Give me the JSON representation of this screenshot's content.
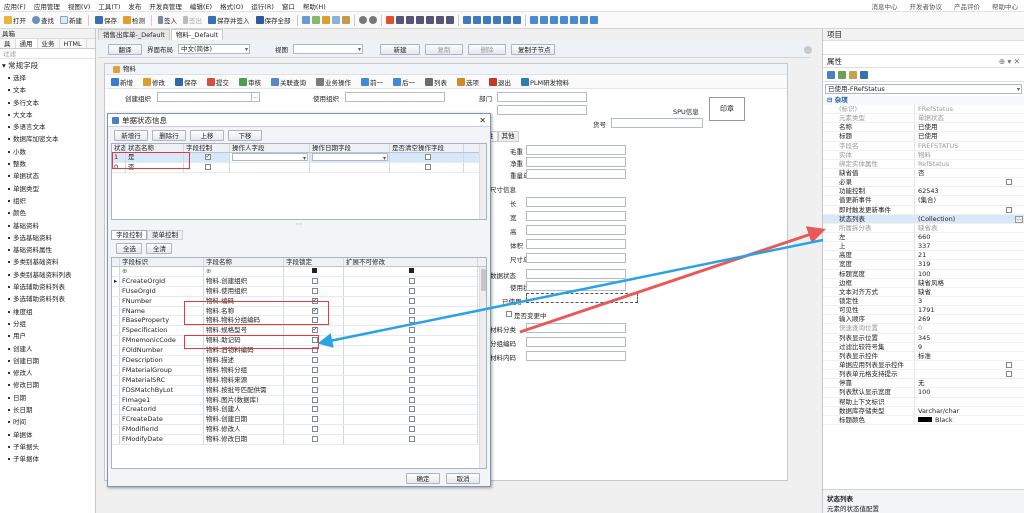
{
  "menu": {
    "items": [
      "应用(F)",
      "应用管理",
      "视图(V)",
      "工具(T)",
      "发布",
      "开发商管理",
      "编辑(E)",
      "格式(O)",
      "运行(R)",
      "窗口",
      "帮助(H)"
    ],
    "right": [
      "消息中心",
      "开发者协议",
      "产品评价",
      "帮助中心"
    ]
  },
  "toolbar": {
    "open": "打开",
    "find": "查找",
    "new": "新建",
    "save": "保存",
    "check": "检测",
    "sign_in": "签入",
    "sign_out": "签出",
    "save_and_sign_in": "保存并签入",
    "save_all": "保存全部"
  },
  "left_panel": {
    "title": "具箱",
    "tabs": [
      "具",
      "通用",
      "业务",
      "HTML"
    ],
    "filter": "过滤",
    "category": "常规字段",
    "items": [
      "选择",
      "文本",
      "多行文本",
      "大文本",
      "多语言文本",
      "数据库加密文本",
      "小数",
      "整数",
      "单据状态",
      "单据类型",
      "组织",
      "颜色",
      "基础资料",
      "多选基础资料",
      "基础资料属性",
      "多类别基础资料",
      "多类别基础资料列表",
      "单选辅助资料列表",
      "多选辅助资料列表",
      "维度组",
      "分组",
      "用户",
      "创建人",
      "创建日期",
      "修改人",
      "修改日期",
      "日期",
      "长日期",
      "时间",
      "单据体",
      "子单据头",
      "子单据体"
    ]
  },
  "doc_tabs": [
    "销售出库单-_Default",
    "物料-_Default"
  ],
  "control_bar": {
    "translate": "翻译",
    "layout_label": "界面布局",
    "layout_value": "中文(简体)",
    "view_label": "视图",
    "new": "新建",
    "copy": "复制",
    "delete": "删除",
    "copy_node": "复制子节点"
  },
  "form": {
    "title": "物料",
    "toolbar": [
      "新增",
      "修改",
      "保存",
      "提交",
      "审核",
      "关联查询",
      "业务操作",
      "前一",
      "后一",
      "列表",
      "选项",
      "退出",
      "PLM研发物料"
    ],
    "fields": {
      "create_org": "创建组织",
      "use_org": "使用组织",
      "dept": "部门",
      "bill_no": "货号",
      "spu": "SPU信息",
      "seal": "印章"
    },
    "tabs": [
      "性",
      "其他"
    ],
    "right_labels": [
      "毛重",
      "净重",
      "重量单位",
      "尺寸信息",
      "长",
      "宽",
      "高",
      "体积",
      "尺寸单位",
      "数据状态",
      "使用状态",
      "已使用",
      "是否变更中",
      "材料分类",
      "分组编码",
      "材料内码"
    ]
  },
  "dialog": {
    "title": "单据状态信息",
    "close": "✕",
    "buttons": [
      "新增行",
      "删除行",
      "上移",
      "下移"
    ],
    "headers": [
      "状态值",
      "状态名称",
      "字段控制",
      "操作人字段",
      "操作日期字段",
      "是否清空操作字段"
    ],
    "rows": [
      {
        "value": "1",
        "name": "是",
        "control": true
      },
      {
        "value": "0",
        "name": "否",
        "control": false
      }
    ],
    "subtabs": [
      "字段控制",
      "菜单控制"
    ],
    "select_all": "全选",
    "select_none": "全清",
    "field_headers": [
      "字段标识",
      "字段名称",
      "字段锁定",
      "扩展不可修改"
    ],
    "field_rows": [
      {
        "id": "FCreateOrgId",
        "name": "物料.创建组织",
        "lock": false
      },
      {
        "id": "FUseOrgId",
        "name": "物料.使用组织",
        "lock": false
      },
      {
        "id": "FNumber",
        "name": "物料.编码",
        "lock": true
      },
      {
        "id": "FName",
        "name": "物料.名称",
        "lock": true
      },
      {
        "id": "FBaseProperty",
        "name": "物料.物料分组编码",
        "lock": false
      },
      {
        "id": "FSpecification",
        "name": "物料.规格型号",
        "lock": true
      },
      {
        "id": "FMnemonicCode",
        "name": "物料.助记码",
        "lock": false
      },
      {
        "id": "FOldNumber",
        "name": "物料.旧物料编码",
        "lock": false
      },
      {
        "id": "FDescription",
        "name": "物料.描述",
        "lock": false
      },
      {
        "id": "FMaterialGroup",
        "name": "物料.物料分组",
        "lock": false
      },
      {
        "id": "FMaterialSRC",
        "name": "物料.物料来源",
        "lock": false
      },
      {
        "id": "FDSMatchByLot",
        "name": "物料.按批号匹配供需",
        "lock": false
      },
      {
        "id": "FImage1",
        "name": "物料.图片(数据库)",
        "lock": false
      },
      {
        "id": "FCreatorId",
        "name": "物料.创建人",
        "lock": false
      },
      {
        "id": "FCreateDate",
        "name": "物料.创建日期",
        "lock": false
      },
      {
        "id": "FModifierId",
        "name": "物料.修改人",
        "lock": false
      },
      {
        "id": "FModifyDate",
        "name": "物料.修改日期",
        "lock": false
      }
    ],
    "ok": "确定",
    "cancel": "取消"
  },
  "right_panel": {
    "title": "项目",
    "properties_title": "属性",
    "object": "已使用-FRefStatus",
    "category": "杂项",
    "props": [
      {
        "k": "(标识)",
        "v": "FRefStatus",
        "grey": true
      },
      {
        "k": "元素类型",
        "v": "单据状态",
        "grey": true
      },
      {
        "k": "名称",
        "v": "已使用"
      },
      {
        "k": "标题",
        "v": "已使用"
      },
      {
        "k": "字段名",
        "v": "FREFSTATUS",
        "grey": true
      },
      {
        "k": "实体",
        "v": "物料",
        "grey": true
      },
      {
        "k": "绑定实体属性",
        "v": "RefStatus",
        "grey": true
      },
      {
        "k": "缺省值",
        "v": "否"
      },
      {
        "k": "必录",
        "v": "",
        "cb": false
      },
      {
        "k": "功能控制",
        "v": "62543"
      },
      {
        "k": "值更新事件",
        "v": "(集合)"
      },
      {
        "k": "即时触发更新事件",
        "v": "",
        "cb": false
      },
      {
        "k": "状态列表",
        "v": "(Collection)",
        "sel": true
      },
      {
        "k": "所属拆分表",
        "v": "缺省表",
        "grey": true
      },
      {
        "k": "左",
        "v": "660"
      },
      {
        "k": "上",
        "v": "337"
      },
      {
        "k": "高度",
        "v": "21"
      },
      {
        "k": "宽度",
        "v": "319"
      },
      {
        "k": "标题宽度",
        "v": "100"
      },
      {
        "k": "边框",
        "v": "缺省风格"
      },
      {
        "k": "文本对齐方式",
        "v": "缺省"
      },
      {
        "k": "锁定性",
        "v": "3"
      },
      {
        "k": "可见性",
        "v": "1791"
      },
      {
        "k": "输入顺序",
        "v": "269"
      },
      {
        "k": "快速查询位置",
        "v": "0",
        "grey": true
      },
      {
        "k": "列表显示位置",
        "v": "345"
      },
      {
        "k": "过滤比较符号集",
        "v": "9"
      },
      {
        "k": "列表显示控件",
        "v": "标准"
      },
      {
        "k": "单据应用列表显示控件",
        "v": "",
        "cb": false
      },
      {
        "k": "列表单元格支持提示",
        "v": "",
        "cb": false
      },
      {
        "k": "停靠",
        "v": "无"
      },
      {
        "k": "列表默认显示宽度",
        "v": "100"
      },
      {
        "k": "帮助上下文标识",
        "v": ""
      },
      {
        "k": "数据库存储类型",
        "v": "Varchar/char"
      },
      {
        "k": "标题颜色",
        "v": "Black",
        "swatch": "#000000"
      }
    ],
    "desc_title": "状态列表",
    "desc_text": "元素的状态值配置"
  },
  "colors": {
    "red_box": "#e23a3a",
    "red_arrow": "#e85a5a",
    "blue_arrow": "#29a3e6",
    "accent": "#1f55a8"
  }
}
